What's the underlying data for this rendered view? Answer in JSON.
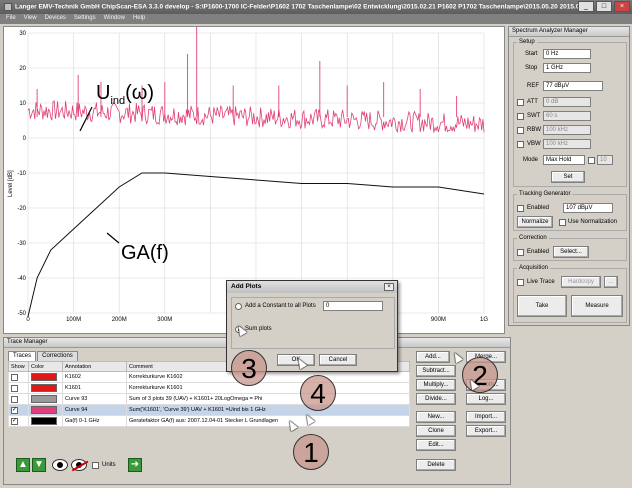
{
  "window": {
    "title": "Langer EMV-Technik GmbH ChipScan-ESA 3.3.0 develop - S:\\P1600-1700 IC-Felder\\P1602 1702 Taschenlampe\\02 Entwicklung\\2015.02.21 P1602 P1702 Taschenlampe\\2015.05.20 2015.05.2",
    "minimize": "_",
    "maximize": "□",
    "close": "×"
  },
  "menu": [
    "File",
    "View",
    "Devices",
    "Settings",
    "Window",
    "Help"
  ],
  "plot": {
    "ylabel": "Level [dB]",
    "yticks": [
      "30",
      "20",
      "10",
      "0",
      "-10",
      "-20",
      "-30",
      "-40",
      "-50"
    ],
    "xticks": [
      "0",
      "100M",
      "200M",
      "300M",
      "900M",
      "1G"
    ],
    "annotation_u_main": "U",
    "annotation_u_sub": "ind",
    "annotation_u_rest": "(ω)",
    "annotation_ga": "GA(f)",
    "colors": {
      "pink": "#e0407a",
      "black": "#111111"
    }
  },
  "spectrum": {
    "title": "Spectrum Analyzer Manager",
    "setup_legend": "Setup",
    "start_label": "Start",
    "start_value": "0 Hz",
    "stop_label": "Stop",
    "stop_value": "1 GHz",
    "ref_label": "REF",
    "ref_value": "77 dBµV",
    "att_label": "ATT",
    "att_value": "0 dB",
    "swt_label": "SWT",
    "swt_value": "60 s",
    "rbw_label": "RBW",
    "rbw_value": "100 kHz",
    "vbw_label": "VBW",
    "vbw_value": "100 kHz",
    "mode_label": "Mode",
    "mode_value": "Max Hold",
    "mode_num": "10",
    "set_button": "Set",
    "tg_legend": "Tracking Generator",
    "tg_enabled": "Enabled",
    "tg_value": "107 dBµV",
    "normalize_button": "Normalize",
    "use_normalization": "Use Normalization",
    "corr_legend": "Correction",
    "corr_enabled": "Enabled",
    "select_button": "Select...",
    "acq_legend": "Acquisition",
    "live_trace": "Live Trace",
    "hardcopy_button": "Hardcopy",
    "dots_button": "...",
    "take_button": "Take",
    "measure_button": "Measure"
  },
  "trace_manager": {
    "title": "Trace Manager",
    "tabs": [
      "Traces",
      "Corrections"
    ],
    "columns": [
      "Show",
      "Color",
      "Annotation",
      "Comment"
    ],
    "rows": [
      {
        "annotation": "K1602",
        "comment": "Korrekturkurve K1602",
        "color": "#e01818",
        "checked": ""
      },
      {
        "annotation": "K1601",
        "comment": "Korrekturkurve K1601",
        "color": "#e01818",
        "checked": ""
      },
      {
        "annotation": "Curve 93",
        "comment": "Sum of 3 plots 39 (UAV) + K1601+ 20LogOmega  = Phi",
        "color": "#999999",
        "checked": ""
      },
      {
        "annotation": "Curve 94",
        "comment": "Sum('K1601', 'Curve 39') UAV + K1601 =Uind bis 1 GHz",
        "color": "#e0407a",
        "checked": "✓"
      },
      {
        "annotation": "Ga(f) 0-1 GHz",
        "comment": "Geratefaktor GA(f)   aus: 2007.12.04-01 Stecker L Grundlagen",
        "color": "#000000",
        "checked": "✓"
      }
    ],
    "buttons": {
      "add": "Add...",
      "merge": "Merge...",
      "subtract": "Subtract...",
      "smooth": "Smooth...",
      "multiply": "Multiply...",
      "log": "Log...",
      "divide": "Divide...",
      "new": "New...",
      "import": "Import...",
      "clone": "Clone",
      "export": "Export...",
      "edit": "Edit...",
      "delete": "Delete"
    },
    "units_label": "Units"
  },
  "dialog": {
    "title": "Add Plots",
    "close": "×",
    "option_constant": "Add a Constant to all Plots",
    "constant_value": "0",
    "option_sum": "Sum plots",
    "ok": "OK",
    "cancel": "Cancel"
  },
  "callouts": [
    "1",
    "2",
    "3",
    "4"
  ]
}
